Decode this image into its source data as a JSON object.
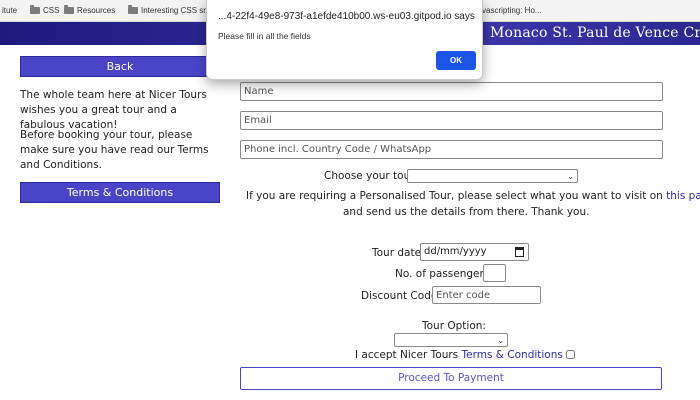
{
  "bookmarks": [
    {
      "label": "itute",
      "folder": false
    },
    {
      "label": "CSS",
      "folder": true
    },
    {
      "label": "Resources",
      "folder": true
    },
    {
      "label": "Interesting CSS sn",
      "folder": true
    },
    {
      "label": "vascripting: Ho...",
      "folder": false
    }
  ],
  "banner": {
    "text": "Monaco  St. Paul de Vence  Cred"
  },
  "left": {
    "back_label": "Back",
    "intro": "The whole team here at Nicer Tours wishes you a great tour and a fabulous vacation!",
    "terms_note": "Before booking your tour, please make sure you have read our Terms and Conditions.",
    "terms_button": "Terms & Conditions"
  },
  "form": {
    "name_placeholder": "Name",
    "email_placeholder": "Email",
    "phone_placeholder": "Phone incl. Country Code / WhatsApp",
    "choose_tour_label": "Choose your tour:",
    "choose_tour_value": "",
    "personal_text_pre": "If you are requiring a Personalised Tour, please select what you want to visit on ",
    "personal_link": "this page",
    "personal_text_post": ",",
    "personal_text_line2": "and send us the details from there. Thank you.",
    "tour_date_label": "Tour date:",
    "tour_date_placeholder": "dd/mm/yyyy",
    "passengers_label": "No. of passengers:",
    "passengers_value": "",
    "discount_label": "Discount Code:",
    "discount_placeholder": "Enter code",
    "tour_option_label": "Tour Option:",
    "tour_option_value": "",
    "accept_text": "I accept Nicer Tours ",
    "accept_link": "Terms & Conditions",
    "accept_checked": false,
    "proceed_label": "Proceed To Payment"
  },
  "dialog": {
    "title": "...4-22f4-49e8-973f-a1efde410b00.ws-eu03.gitpod.io says",
    "message": "Please fill in all the fields",
    "ok_label": "OK"
  },
  "colors": {
    "brand_purple": "#4a45c7",
    "banner_blue": "#2d2a98",
    "dialog_ok_blue": "#1a55e8",
    "link": "#2e2ab0"
  }
}
